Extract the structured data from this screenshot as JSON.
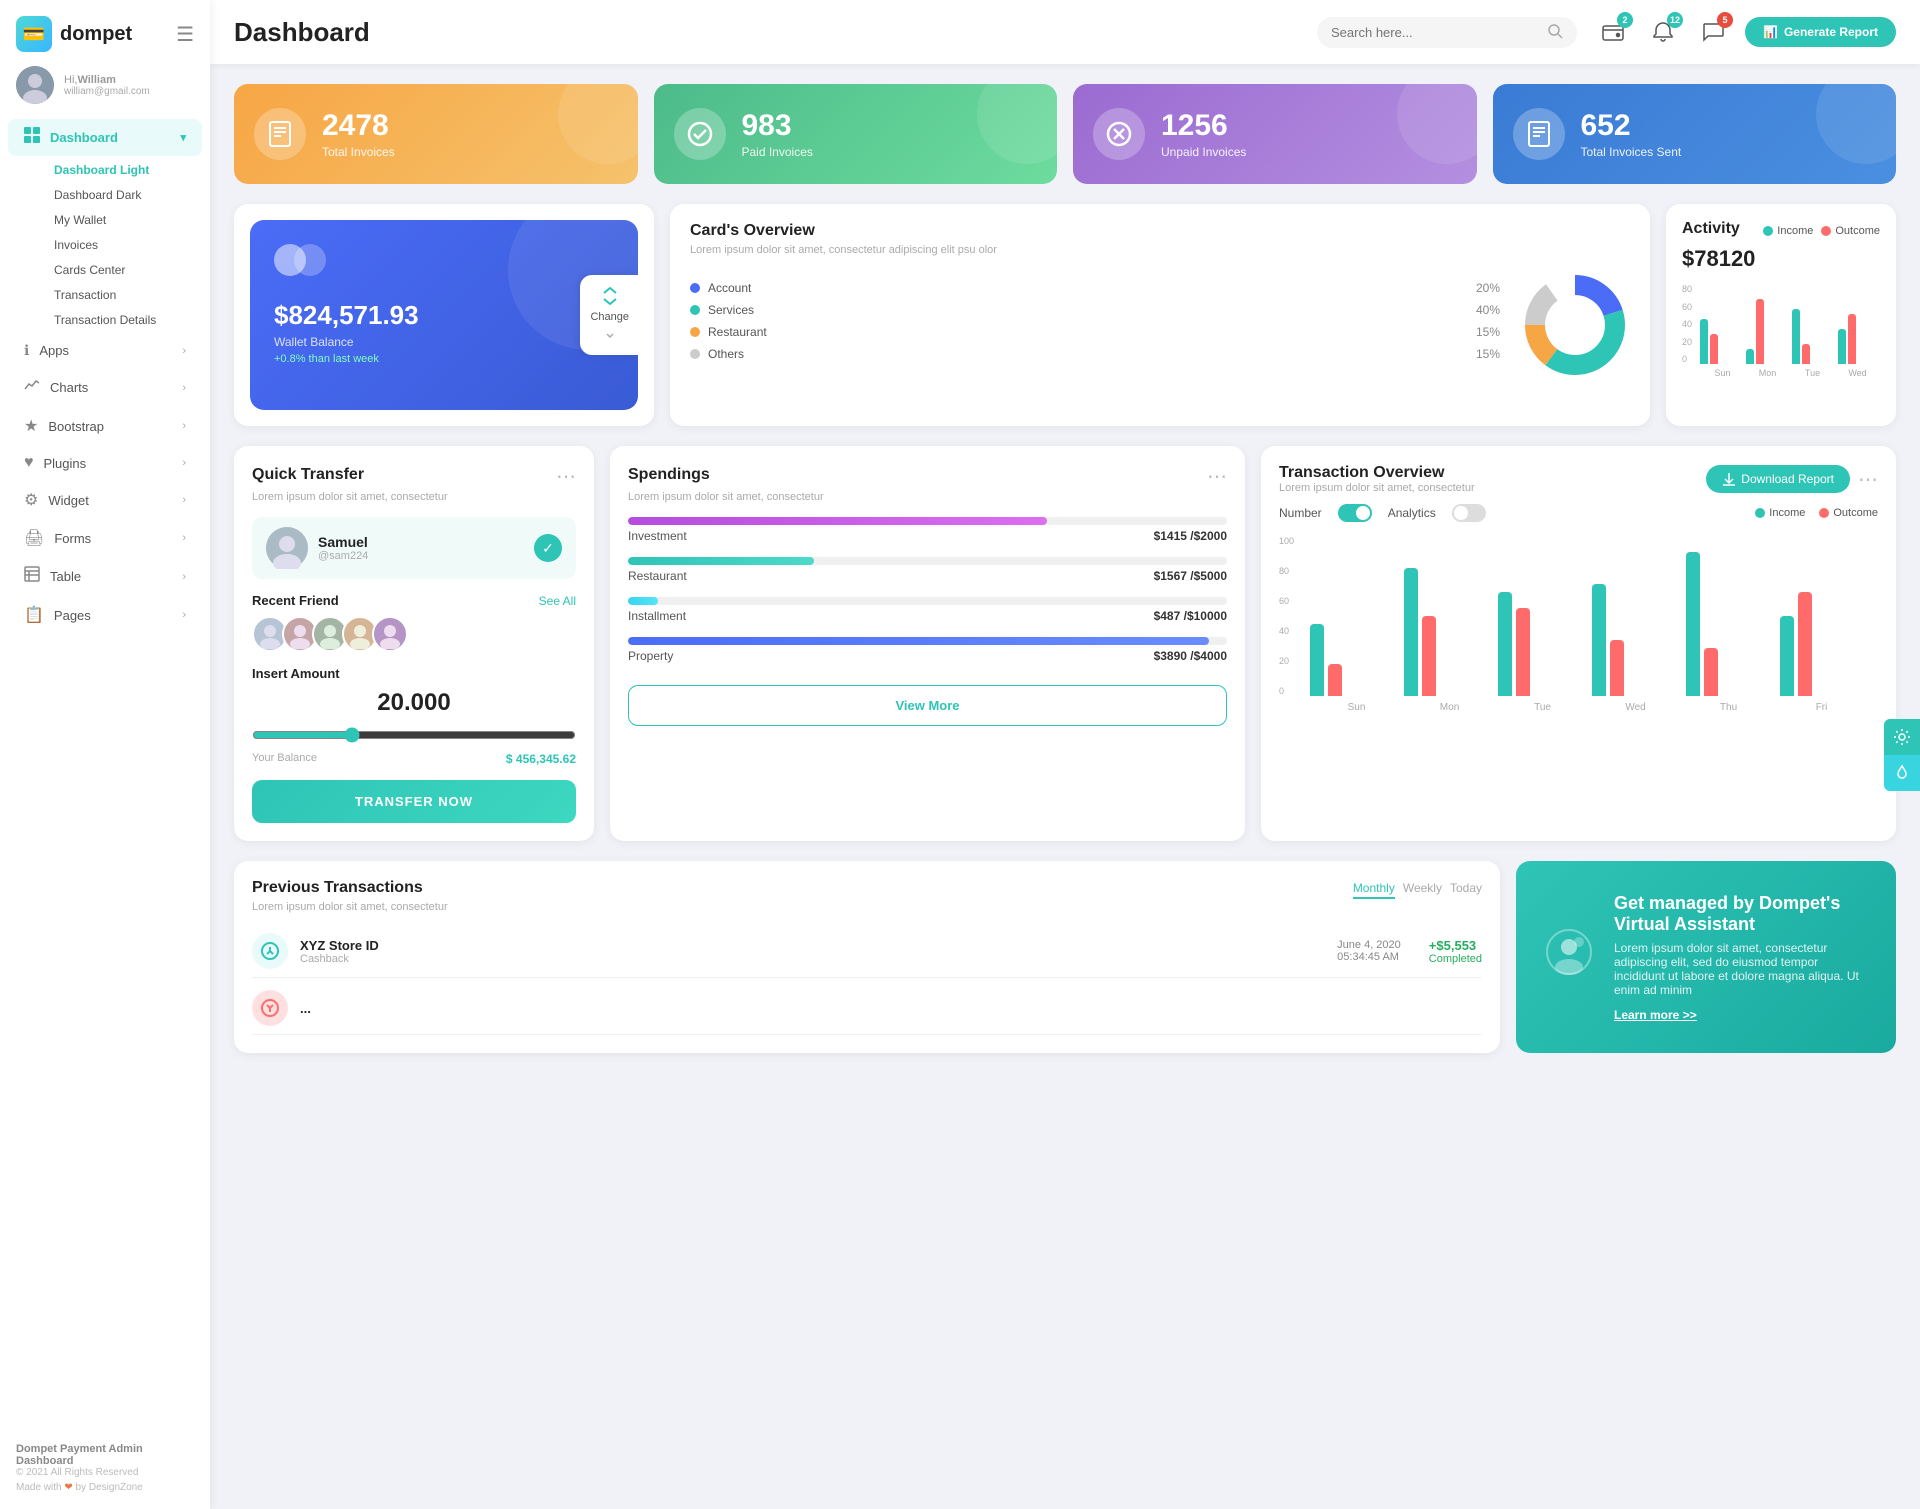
{
  "app": {
    "logo": "💳",
    "name": "dompet",
    "hamburger": "☰"
  },
  "user": {
    "greeting": "Hi,",
    "name": "William",
    "email": "william@gmail.com",
    "avatar": "👤"
  },
  "sidebar": {
    "nav": [
      {
        "id": "dashboard",
        "icon": "⊞",
        "label": "Dashboard",
        "active": true,
        "hasDropdown": true
      },
      {
        "id": "apps",
        "icon": "ℹ",
        "label": "Apps",
        "active": false,
        "hasArrow": true
      },
      {
        "id": "charts",
        "icon": "📊",
        "label": "Charts",
        "active": false,
        "hasArrow": true
      },
      {
        "id": "bootstrap",
        "icon": "★",
        "label": "Bootstrap",
        "active": false,
        "hasArrow": true
      },
      {
        "id": "plugins",
        "icon": "♥",
        "label": "Plugins",
        "active": false,
        "hasArrow": true
      },
      {
        "id": "widget",
        "icon": "⚙",
        "label": "Widget",
        "active": false,
        "hasArrow": true
      },
      {
        "id": "forms",
        "icon": "🖨",
        "label": "Forms",
        "active": false,
        "hasArrow": true
      },
      {
        "id": "table",
        "icon": "☰",
        "label": "Table",
        "active": false,
        "hasArrow": true
      },
      {
        "id": "pages",
        "icon": "📋",
        "label": "Pages",
        "active": false,
        "hasArrow": true
      }
    ],
    "sub_items": [
      "Dashboard Light",
      "Dashboard Dark",
      "My Wallet",
      "Invoices",
      "Cards Center",
      "Transaction",
      "Transaction Details"
    ],
    "footer": {
      "brand": "Dompet Payment Admin Dashboard",
      "year": "© 2021 All Rights Reserved",
      "made": "Made with",
      "heart": "❤",
      "by": "by DesignZone"
    }
  },
  "header": {
    "title": "Dashboard",
    "search_placeholder": "Search here...",
    "search_icon": "🔍",
    "bell_badge": "12",
    "wallet_badge": "2",
    "chat_badge": "5",
    "generate_btn": "Generate Report",
    "report_icon": "📊"
  },
  "stat_cards": [
    {
      "id": "total-invoices",
      "num": "2478",
      "label": "Total Invoices",
      "icon": "📋",
      "color": "card-orange"
    },
    {
      "id": "paid-invoices",
      "num": "983",
      "label": "Paid Invoices",
      "icon": "✅",
      "color": "card-green"
    },
    {
      "id": "unpaid-invoices",
      "num": "1256",
      "label": "Unpaid Invoices",
      "icon": "❌",
      "color": "card-purple"
    },
    {
      "id": "sent-invoices",
      "num": "652",
      "label": "Total Invoices Sent",
      "icon": "📤",
      "color": "card-blue-dark"
    }
  ],
  "wallet": {
    "circles": [
      "",
      ""
    ],
    "amount": "$824,571.93",
    "label": "Wallet Balance",
    "change": "+0.8% than last week",
    "change_icon": "🔄",
    "btn_label": "Change"
  },
  "card_overview": {
    "title": "Card's Overview",
    "subtitle": "Lorem ipsum dolor sit amet, consectetur adipiscing elit psu olor",
    "items": [
      {
        "label": "Account",
        "pct": "20%",
        "color": "#4a6cf7"
      },
      {
        "label": "Services",
        "pct": "40%",
        "color": "#2ec4b6"
      },
      {
        "label": "Restaurant",
        "pct": "15%",
        "color": "#f7a645"
      },
      {
        "label": "Others",
        "pct": "15%",
        "color": "#cccccc"
      }
    ]
  },
  "activity": {
    "title": "Activity",
    "amount": "$78120",
    "income_label": "Income",
    "outcome_label": "Outcome",
    "bars": [
      {
        "day": "Sun",
        "income": 45,
        "outcome": 30
      },
      {
        "day": "Mon",
        "income": 15,
        "outcome": 65
      },
      {
        "day": "Tue",
        "income": 55,
        "outcome": 20
      },
      {
        "day": "Wed",
        "income": 35,
        "outcome": 50
      }
    ],
    "y_labels": [
      "80",
      "60",
      "40",
      "20",
      "0"
    ]
  },
  "quick_transfer": {
    "title": "Quick Transfer",
    "subtitle": "Lorem ipsum dolor sit amet, consectetur",
    "featured_user": {
      "name": "Samuel",
      "handle": "@sam224",
      "avatar": "👤"
    },
    "recent_label": "Recent Friend",
    "see_all": "See All",
    "friends": [
      "👤",
      "👤",
      "👤",
      "👤",
      "👤"
    ],
    "insert_label": "Insert Amount",
    "amount": "20.000",
    "balance_label": "Your Balance",
    "balance_value": "$ 456,345.62",
    "transfer_btn": "TRANSFER NOW"
  },
  "spendings": {
    "title": "Spendings",
    "subtitle": "Lorem ipsum dolor sit amet, consectetur",
    "items": [
      {
        "name": "Investment",
        "amount": "$1415",
        "max": "$2000",
        "pct": 70,
        "color": "#b44cdd"
      },
      {
        "name": "Restaurant",
        "amount": "$1567",
        "max": "$5000",
        "pct": 31,
        "color": "#2ec4b6"
      },
      {
        "name": "Installment",
        "amount": "$487",
        "max": "$10000",
        "pct": 5,
        "color": "#38d4f0"
      },
      {
        "name": "Property",
        "amount": "$3890",
        "max": "$4000",
        "pct": 97,
        "color": "#4a6cf7"
      }
    ],
    "view_more_btn": "View More"
  },
  "txn_overview": {
    "title": "Transaction Overview",
    "subtitle": "Lorem ipsum dolor sit amet, consectetur",
    "download_btn": "Download Report",
    "toggle_number": "Number",
    "toggle_analytics": "Analytics",
    "income_label": "Income",
    "outcome_label": "Outcome",
    "bars": [
      {
        "day": "Sun",
        "income": 45,
        "outcome": 20
      },
      {
        "day": "Mon",
        "income": 80,
        "outcome": 50
      },
      {
        "day": "Tue",
        "income": 65,
        "outcome": 55
      },
      {
        "day": "Wed",
        "income": 70,
        "outcome": 35
      },
      {
        "day": "Thu",
        "income": 90,
        "outcome": 30
      },
      {
        "day": "Fri",
        "income": 50,
        "outcome": 65
      }
    ],
    "y_labels": [
      "100",
      "80",
      "60",
      "40",
      "20",
      "0"
    ]
  },
  "prev_transactions": {
    "title": "Previous Transactions",
    "subtitle": "Lorem ipsum dolor sit amet, consectetur",
    "filters": [
      "Monthly",
      "Weekly",
      "Today"
    ],
    "active_filter": "Monthly",
    "items": [
      {
        "icon": "⬇",
        "name": "XYZ Store ID",
        "type": "Cashback",
        "date": "June 4, 2020",
        "time": "05:34:45 AM",
        "amount": "+$5,553",
        "status": "Completed"
      }
    ]
  },
  "va_banner": {
    "icon": "💰",
    "title": "Get managed by Dompet's Virtual Assistant",
    "subtitle": "Lorem ipsum dolor sit amet, consectetur adipiscing elit, sed do eiusmod tempor incididunt ut labore et dolore magna aliqua. Ut enim ad minim",
    "link": "Learn more >>"
  },
  "right_panel": {
    "gear_icon": "⚙",
    "water_icon": "💧"
  }
}
